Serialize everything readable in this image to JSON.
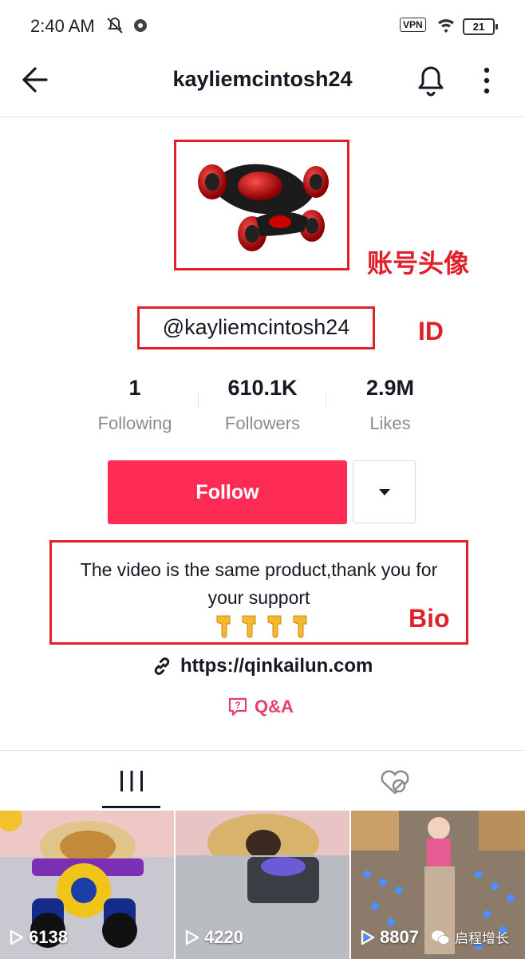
{
  "status_bar": {
    "time": "2:40 AM",
    "vpn": "VPN",
    "battery": "21"
  },
  "header": {
    "title": "kayliemcintosh24"
  },
  "profile": {
    "avatar_annotation": "账号头像",
    "handle": "@kayliemcintosh24",
    "id_annotation": "ID",
    "stats": [
      {
        "value": "1",
        "label": "Following"
      },
      {
        "value": "610.1K",
        "label": "Followers"
      },
      {
        "value": "2.9M",
        "label": "Likes"
      }
    ],
    "follow_label": "Follow",
    "bio_line1": "The video is the same product,thank you for",
    "bio_line2": "your support",
    "bio_emojis": "👇👇👇👇",
    "bio_annotation": "Bio",
    "link": "https://qinkailun.com",
    "qa_label": "Q&A"
  },
  "videos": [
    {
      "views": "6138"
    },
    {
      "views": "4220"
    },
    {
      "views": "8807"
    }
  ],
  "watermark": "启程增长",
  "colors": {
    "primary": "#fe2c55",
    "annotation": "#e0202b",
    "qa": "#e6406a"
  }
}
